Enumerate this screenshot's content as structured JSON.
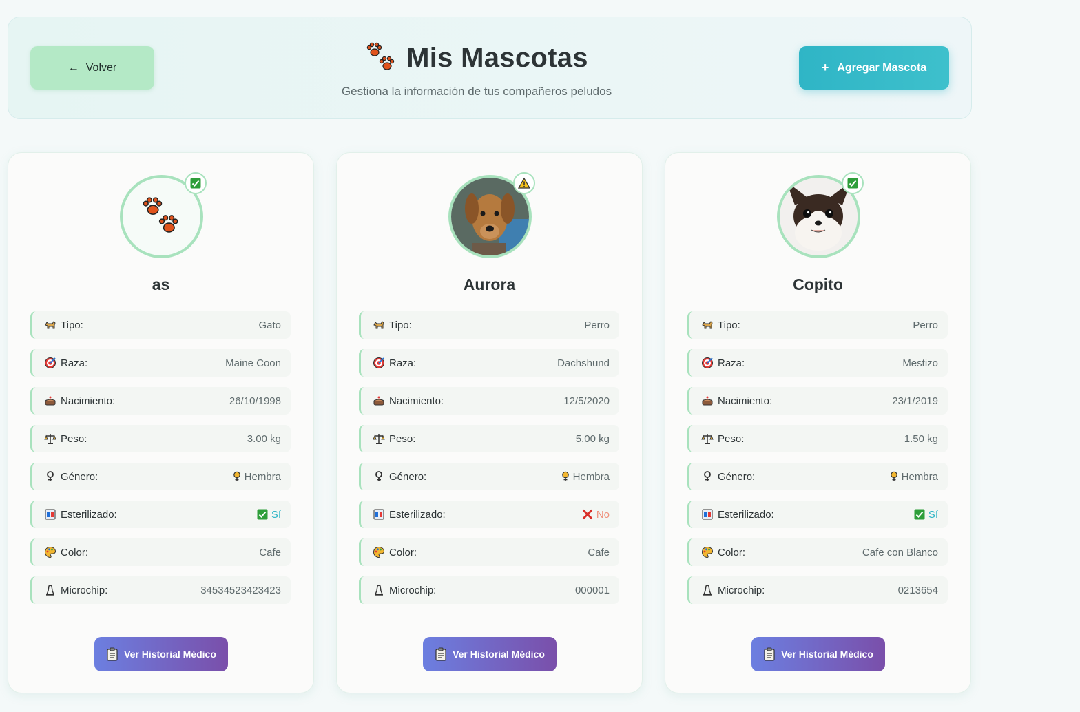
{
  "header": {
    "back_label": "Volver",
    "back_icon": "←",
    "title": "Mis Mascotas",
    "subtitle": "Gestiona la información de tus compañeros peludos",
    "add_label": "Agregar Mascota",
    "add_icon": "+"
  },
  "labels": {
    "tipo": "Tipo:",
    "raza": "Raza:",
    "nacimiento": "Nacimiento:",
    "peso": "Peso:",
    "genero": "Género:",
    "esterilizado": "Esterilizado:",
    "color": "Color:",
    "microchip": "Microchip:",
    "historial": "Ver Historial Médico"
  },
  "pets": [
    {
      "name": "as",
      "photo": "paw-placeholder",
      "status_badge": "check",
      "tipo": "Gato",
      "raza": "Maine Coon",
      "nacimiento": "26/10/1998",
      "peso": "3.00 kg",
      "genero": "Hembra",
      "esterilizado": "Sí",
      "color": "Cafe",
      "microchip": "34534523423423"
    },
    {
      "name": "Aurora",
      "photo": "dachshund-photo",
      "status_badge": "warning",
      "tipo": "Perro",
      "raza": "Dachshund",
      "nacimiento": "12/5/2020",
      "peso": "5.00 kg",
      "genero": "Hembra",
      "esterilizado": "No",
      "color": "Cafe",
      "microchip": "000001"
    },
    {
      "name": "Copito",
      "photo": "chihuahua-photo",
      "status_badge": "check",
      "tipo": "Perro",
      "raza": "Mestizo",
      "nacimiento": "23/1/2019",
      "peso": "1.50 kg",
      "genero": "Hembra",
      "esterilizado": "Sí",
      "color": "Cafe con Blanco",
      "microchip": "0213654"
    }
  ],
  "colors": {
    "accent_teal": "#2fb5c6",
    "accent_green": "#a8e2bd",
    "back_button": "#b4e9c6",
    "history_button_start": "#6c7fe0",
    "history_button_end": "#7a4faa",
    "no_color": "#f08f7a"
  }
}
